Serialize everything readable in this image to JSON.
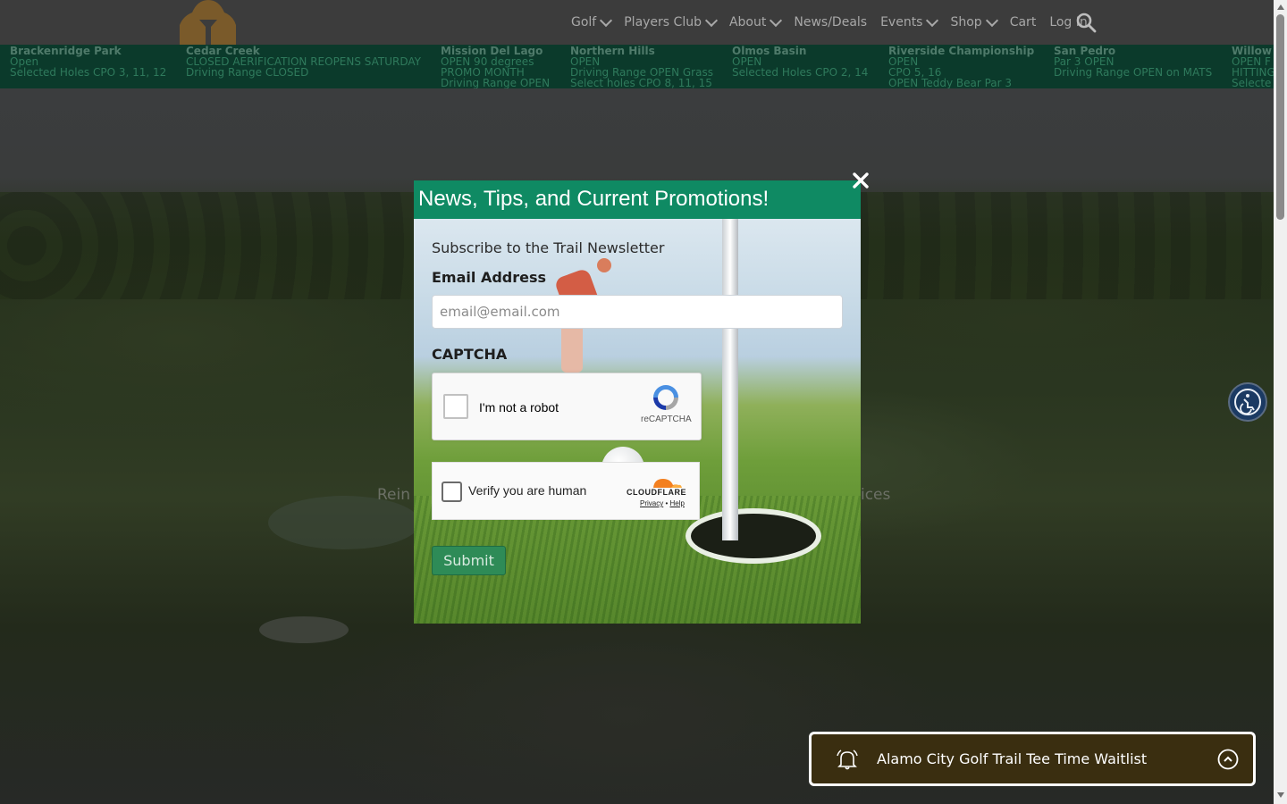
{
  "hero": {
    "tagline_left": "Rein",
    "tagline_right": "rices"
  },
  "nav": {
    "items": [
      {
        "label": "Golf",
        "dropdown": true
      },
      {
        "label": "Players Club",
        "dropdown": true
      },
      {
        "label": "About",
        "dropdown": true
      },
      {
        "label": "News/Deals",
        "dropdown": false
      },
      {
        "label": "Events",
        "dropdown": true
      },
      {
        "label": "Shop",
        "dropdown": true
      },
      {
        "label": "Cart",
        "dropdown": false
      },
      {
        "label": "Log In",
        "dropdown": false
      }
    ],
    "search_icon": "search-icon",
    "logo_icon": "tree-logo"
  },
  "courses": [
    {
      "name": "Brackenridge Park",
      "lines": [
        "Open",
        "Selected Holes CPO 3, 11, 12"
      ]
    },
    {
      "name": "Cedar Creek",
      "lines": [
        "CLOSED AERIFICATION REOPENS SATURDAY",
        "Driving Range CLOSED"
      ]
    },
    {
      "name": "Mission Del Lago",
      "lines": [
        "OPEN 90 degrees",
        "PROMO MONTH",
        "Driving Range OPEN"
      ]
    },
    {
      "name": "Northern Hills",
      "lines": [
        "OPEN",
        "Driving Range OPEN Grass",
        "Select holes CPO 8, 11, 15"
      ]
    },
    {
      "name": "Olmos Basin",
      "lines": [
        "OPEN",
        "Selected Holes CPO 2, 14"
      ]
    },
    {
      "name": "Riverside Championship",
      "lines": [
        "OPEN",
        "CPO 5, 16",
        "OPEN Teddy Bear Par 3"
      ]
    },
    {
      "name": "San Pedro",
      "lines": [
        "Par 3 OPEN",
        "Driving Range OPEN on MATS"
      ]
    },
    {
      "name": "Willow",
      "lines": [
        "OPEN F",
        "HITTING",
        "Selecte"
      ]
    }
  ],
  "modal": {
    "title": "News, Tips, and Current Promotions!",
    "subtitle": "Subscribe to the Trail Newsletter",
    "email_label": "Email Address",
    "email_placeholder": "email@email.com",
    "email_value": "",
    "captcha_label": "CAPTCHA",
    "recaptcha_text": "I'm not a robot",
    "recaptcha_brand": "reCAPTCHA",
    "turnstile_text": "Verify you are human",
    "turnstile_brand": "CLOUDFLARE",
    "turnstile_privacy": "Privacy",
    "turnstile_sep": "•",
    "turnstile_help": "Help",
    "submit_label": "Submit",
    "close_icon": "close-icon"
  },
  "waitlist": {
    "label": "Alamo City Golf Trail Tee Time Waitlist",
    "bell_icon": "bell-icon",
    "expand_icon": "chevron-up-circle-icon"
  },
  "accessibility": {
    "icon": "accessibility-icon"
  },
  "colors": {
    "header_bg": "#3c3c3c",
    "ticker_bg": "#0b3a2b",
    "modal_header": "#0f8a63",
    "submit_bg": "#2e8b57",
    "waitlist_bg": "#3a2e10"
  }
}
